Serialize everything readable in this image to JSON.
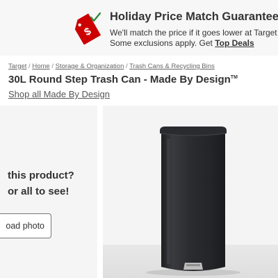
{
  "promo": {
    "title": "Holiday Price Match Guarantee",
    "line1": "We'll match the price if it goes lower at Target be",
    "line2_prefix": "Some exclusions apply. Get ",
    "link_label": "Top Deals",
    "icon": "price-tag-dollar-icon"
  },
  "breadcrumb": {
    "items": [
      "Target",
      "Home",
      "Storage & Organization",
      "Trash Cans & Recycling Bins"
    ],
    "separator": "/"
  },
  "product": {
    "title": "30L Round Step Trash Can - Made By Design",
    "trademark": "TM",
    "brand_link": "Shop all Made By Design"
  },
  "ugc": {
    "heading": "this product?",
    "subheading": "or all to see!",
    "upload_label": "oad photo"
  },
  "colors": {
    "brand_red": "#cc0000",
    "check_green": "#2e8b3d",
    "can_body": "#2a2b2e"
  }
}
